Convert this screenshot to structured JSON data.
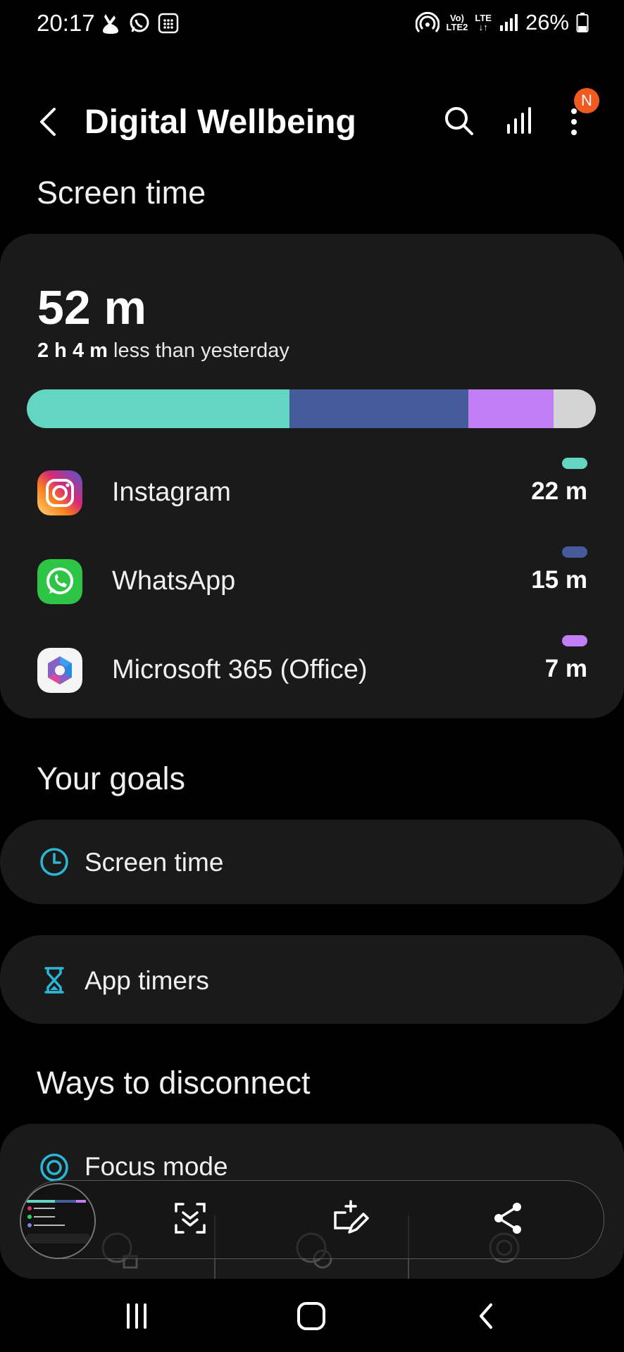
{
  "status_bar": {
    "time": "20:17",
    "network_top": "Vo)",
    "network_bottom": "LTE2",
    "lte_top": "LTE",
    "lte_bottom": "↓↑",
    "battery": "26%"
  },
  "header": {
    "title": "Digital Wellbeing",
    "badge": "N"
  },
  "screen_time": {
    "section_title": "Screen time",
    "total": "52 m",
    "compare_bold": "2 h 4 m",
    "compare_rest": " less than yesterday",
    "bar_segments": [
      {
        "name": "Instagram",
        "fraction": 0.462,
        "color": "#63d6c2"
      },
      {
        "name": "WhatsApp",
        "fraction": 0.314,
        "color": "#465b9a"
      },
      {
        "name": "Microsoft 365 (Office)",
        "fraction": 0.15,
        "color": "#c37ef5"
      },
      {
        "name": "Other",
        "fraction": 0.074,
        "color": "#d4d4d4"
      }
    ],
    "apps": [
      {
        "name": "Instagram",
        "time": "22 m",
        "color": "#63d6c2",
        "icon": "instagram-icon"
      },
      {
        "name": "WhatsApp",
        "time": "15 m",
        "color": "#465b9a",
        "icon": "whatsapp-icon"
      },
      {
        "name": "Microsoft 365 (Office)",
        "time": "7 m",
        "color": "#c37ef5",
        "icon": "microsoft-365-icon"
      }
    ]
  },
  "goals": {
    "section_title": "Your goals",
    "items": [
      {
        "label": "Screen time",
        "icon": "clock-icon"
      },
      {
        "label": "App timers",
        "icon": "hourglass-icon"
      }
    ]
  },
  "disconnect": {
    "section_title": "Ways to disconnect",
    "items": [
      {
        "label": "Focus mode",
        "icon": "focus-mode-icon"
      }
    ]
  },
  "colors": {
    "accent": "#2ab7d6",
    "card": "#1a1a1a",
    "badge": "#f05a1e"
  }
}
